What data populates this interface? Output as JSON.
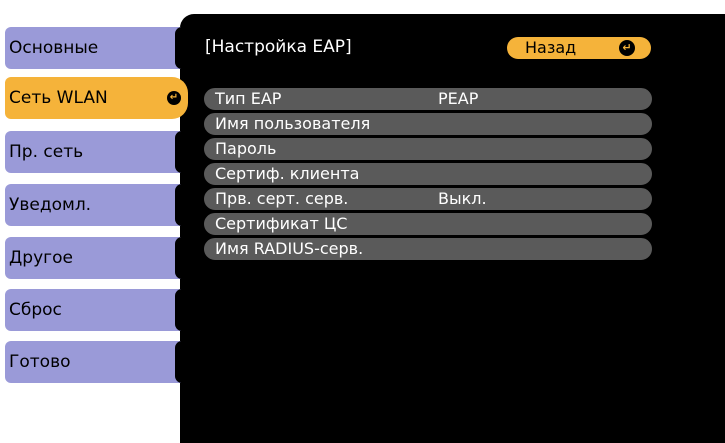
{
  "sidebar": {
    "items": [
      {
        "label": "Основные"
      },
      {
        "label": "Сеть WLAN"
      },
      {
        "label": "Пр. сеть"
      },
      {
        "label": "Уведомл."
      },
      {
        "label": "Другое"
      },
      {
        "label": "Сброс"
      },
      {
        "label": "Готово"
      }
    ],
    "active_index": 1
  },
  "header": {
    "title": "[Настройка EAP]",
    "back_label": "Назад"
  },
  "rows": [
    {
      "label": "Тип EAP",
      "value": "PEAP"
    },
    {
      "label": "Имя пользователя",
      "value": ""
    },
    {
      "label": "Пароль",
      "value": ""
    },
    {
      "label": "Сертиф. клиента",
      "value": ""
    },
    {
      "label": "Прв. серт. серв.",
      "value": "Выкл."
    },
    {
      "label": "Сертификат ЦС",
      "value": ""
    },
    {
      "label": "Имя RADIUS-серв.",
      "value": ""
    }
  ],
  "colors": {
    "accent": "#f5b33a",
    "sidebar_item": "#9a9ad8",
    "panel": "#000000",
    "row": "#5a5a5a"
  },
  "icons": {
    "enter": "enter-icon"
  }
}
